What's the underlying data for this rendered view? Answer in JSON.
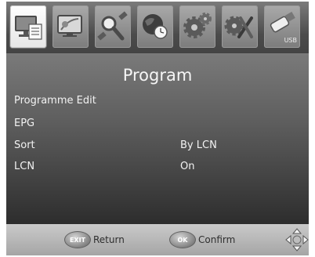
{
  "menu": {
    "tabs": [
      {
        "icon": "tv-program-icon",
        "text": "",
        "active": true
      },
      {
        "icon": "picture-icon",
        "text": ""
      },
      {
        "icon": "channel-search-icon",
        "text": ""
      },
      {
        "icon": "time-icon",
        "text": ""
      },
      {
        "icon": "settings-icon",
        "text": ""
      },
      {
        "icon": "system-tools-icon",
        "text": ""
      },
      {
        "icon": "usb-icon",
        "text": "USB"
      }
    ]
  },
  "page": {
    "title": "Program",
    "rows": [
      {
        "label": "Programme Edit",
        "value": ""
      },
      {
        "label": "EPG",
        "value": ""
      },
      {
        "label": "Sort",
        "value": "By LCN"
      },
      {
        "label": "LCN",
        "value": "On"
      }
    ]
  },
  "footer": {
    "exit_key": "EXIT",
    "exit_label": "Return",
    "ok_key": "OK",
    "ok_label": "Confirm",
    "nav_icon": "dpad-icon"
  }
}
